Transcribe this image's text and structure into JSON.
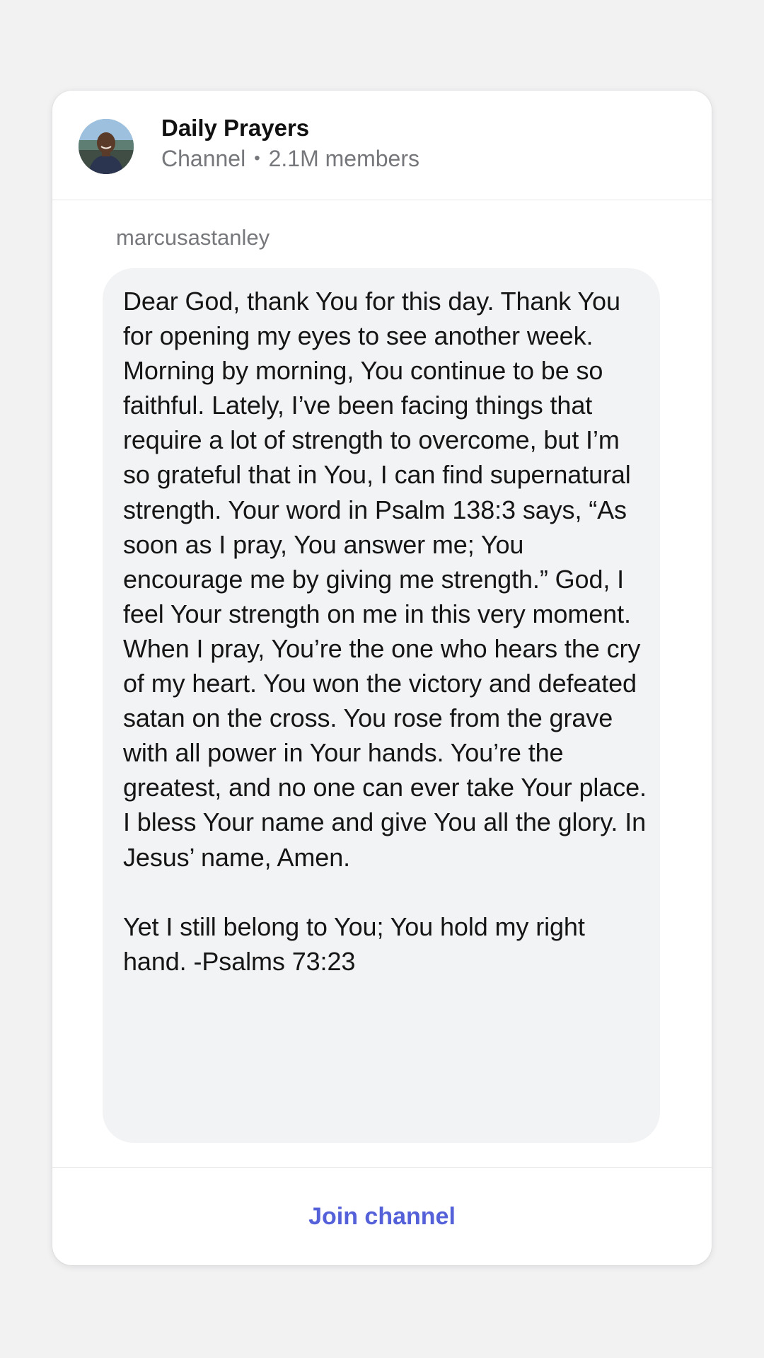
{
  "channel": {
    "name": "Daily Prayers",
    "type": "Channel",
    "separator": "•",
    "members": "2.1M members"
  },
  "post": {
    "author": "marcusastanley",
    "body": "Dear God, thank You for this day. Thank You for opening my eyes to see another week. Morning by morning, You continue to be so faithful. Lately, I’ve been facing things that require a lot of strength to overcome, but I’m so grateful that in You, I can find supernatural strength. Your word in Psalm 138:3 says, “As soon as I pray, You answer me; You encourage me by giving me strength.” God, I feel Your strength on me in this very moment. When I pray, You’re the one who hears the cry of my heart. You won the victory and defeated satan on the cross. You rose from the grave with all power in Your hands. You’re the greatest, and no one can ever take Your place. I bless Your name and give You all the glory. In Jesus’ name, Amen.\n\nYet I still belong to You; You hold my right hand. -Psalms 73:23"
  },
  "actions": {
    "join_label": "Join channel"
  },
  "colors": {
    "accent": "#5561d9",
    "bubble": "#f2f3f5",
    "background": "#f2f2f3",
    "muted_text": "#76777b"
  },
  "icons": {
    "avatar": "profile-photo"
  }
}
